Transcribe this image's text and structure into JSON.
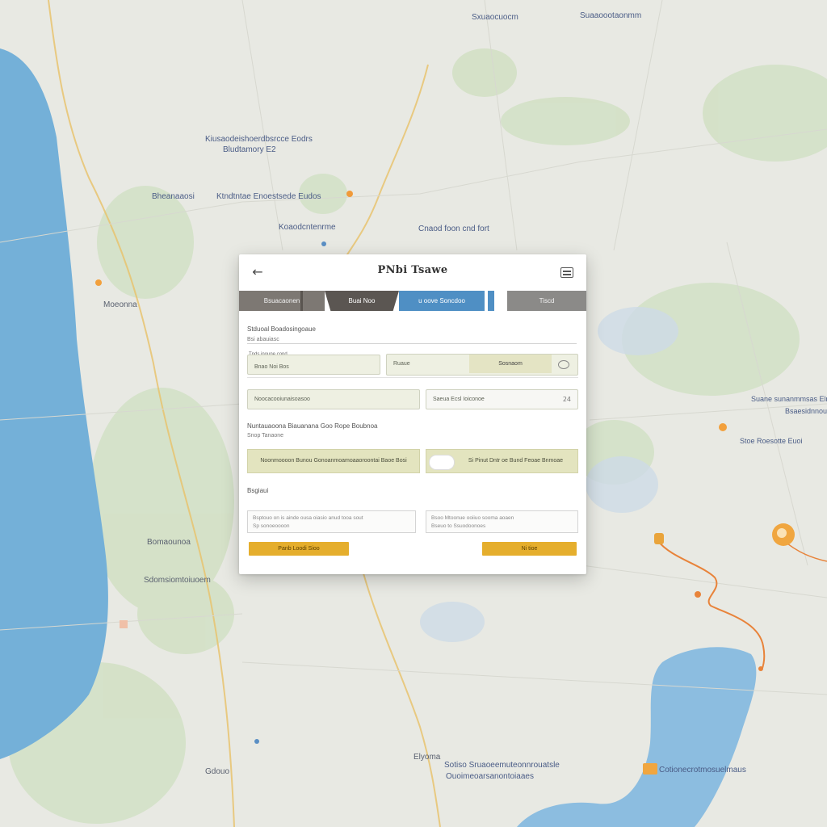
{
  "map": {
    "labels": [
      "Sxuaocuocm",
      "Suaaoootaonmm",
      "Kiusaodeishoerdbsrcce Eodrs",
      "Bludtamory E2",
      "Bheanaaosi",
      "Ktndtntae Enoestsede Eudos",
      "Koaodcntenrme",
      "Cnaod foon cnd fort",
      "Moeonna",
      "Suane sunanmmsas Elnes",
      "Bsaesidnnouen",
      "Stoe Roesotte Euoi",
      "Bomaounoa",
      "Sdomsiomtoiuoem",
      "Sotiso Sruaoeemuteonnrouatsle",
      "Ouoimeoarsanontoiaaes",
      "Cotionecrotmosuelmaus",
      "Elyoma",
      "Gdouo"
    ],
    "colors": {
      "land": "#e8e9e3",
      "water": "#6faed6",
      "green": "#d2e0c4",
      "route": "#e8833a",
      "road": "#e6c06a"
    }
  },
  "dialog": {
    "back_icon": "back-arrow-icon",
    "title": "PNbi Tsawe",
    "menu_icon": "menu-icon",
    "tabs": [
      {
        "label": "Bsuacaonen"
      },
      {
        "label": "Buai Noo"
      },
      {
        "label": "u  oove Soncdoo"
      },
      {
        "label": "Tiscd"
      }
    ],
    "section1": {
      "title": "Stduoal Boadosingoaue",
      "subtitle": "Bsi abauiasc"
    },
    "row1": {
      "left_label": "Tnds inoune cond",
      "left_value": "Bnao Noi Bos",
      "right_value": "Ruaue",
      "right_button": "Sosnaom"
    },
    "row2": {
      "left_value": "Noocacooiunaisoasoo",
      "right_value": "Saeua Ecsl Ioiconoe",
      "right_chevron": "24"
    },
    "section2": {
      "title": "Nuntauaoona Biauanana Goo Rope Boubnoa",
      "subtitle": "Snop  Tanaone"
    },
    "options": {
      "left": "Noonmoooon  Bunou  Gonoanmoamoaaoroontai Baoe Bosi",
      "right": "Si  Pinut  Dntr  oe  Bund Feoae  Bnmoae"
    },
    "section3": {
      "title": "Bsgiaui"
    },
    "notes": {
      "left_line1": "Bsptouo  on  is ainde  ousa oiasio anud tooa sout",
      "left_line2": "Sp sonoeoooon",
      "right_line1": "Bsoo  Mtoonue ooiiuo sooma aoaen",
      "right_line2": "Bseuo  to  Ssuodoonoes"
    },
    "buttons": {
      "primary": "Panb Loodi  Sioo",
      "secondary": "Ni  tioe"
    }
  }
}
